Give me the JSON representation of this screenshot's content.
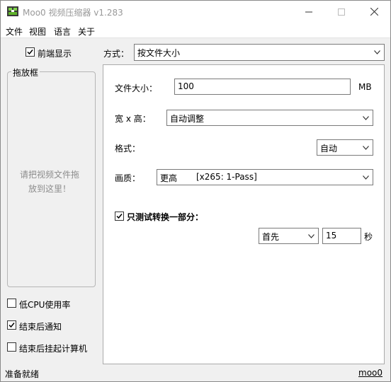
{
  "window": {
    "title": "Moo0 视频压缩器 v1.283"
  },
  "menu": {
    "items": [
      "文件",
      "视图",
      "语言",
      "关于"
    ]
  },
  "left": {
    "always_on_top": {
      "label": "前端显示",
      "checked": true
    },
    "drop_box": {
      "title": "拖放框",
      "hint_line1": "请把视频文件拖",
      "hint_line2": "放到这里！"
    },
    "low_cpu": {
      "label": "低CPU使用率",
      "checked": false
    },
    "notify": {
      "label": "结束后通知",
      "checked": true
    },
    "hibernate": {
      "label": "结束后挂起计算机",
      "checked": false
    }
  },
  "method": {
    "label": "方式：",
    "value": "按文件大小"
  },
  "settings": {
    "size": {
      "label": "文件大小：",
      "value": "100",
      "unit": "MB"
    },
    "dimensions": {
      "label": "宽 x 高：",
      "value": "自动调整"
    },
    "format": {
      "label": "格式：",
      "value": "自动"
    },
    "quality": {
      "label": "画质：",
      "value": "更高",
      "detail": "[x265: 1-Pass]"
    },
    "test_part": {
      "label": "只测试转换一部分：",
      "checked": true
    },
    "part_position": {
      "value": "首先"
    },
    "part_seconds": {
      "value": "15",
      "unit": "秒"
    }
  },
  "status": {
    "text": "准备就绪",
    "link": "moo0"
  },
  "colors": {
    "title_text": "#999999",
    "link": "#000000",
    "panel_border": "#aaaaaa"
  }
}
